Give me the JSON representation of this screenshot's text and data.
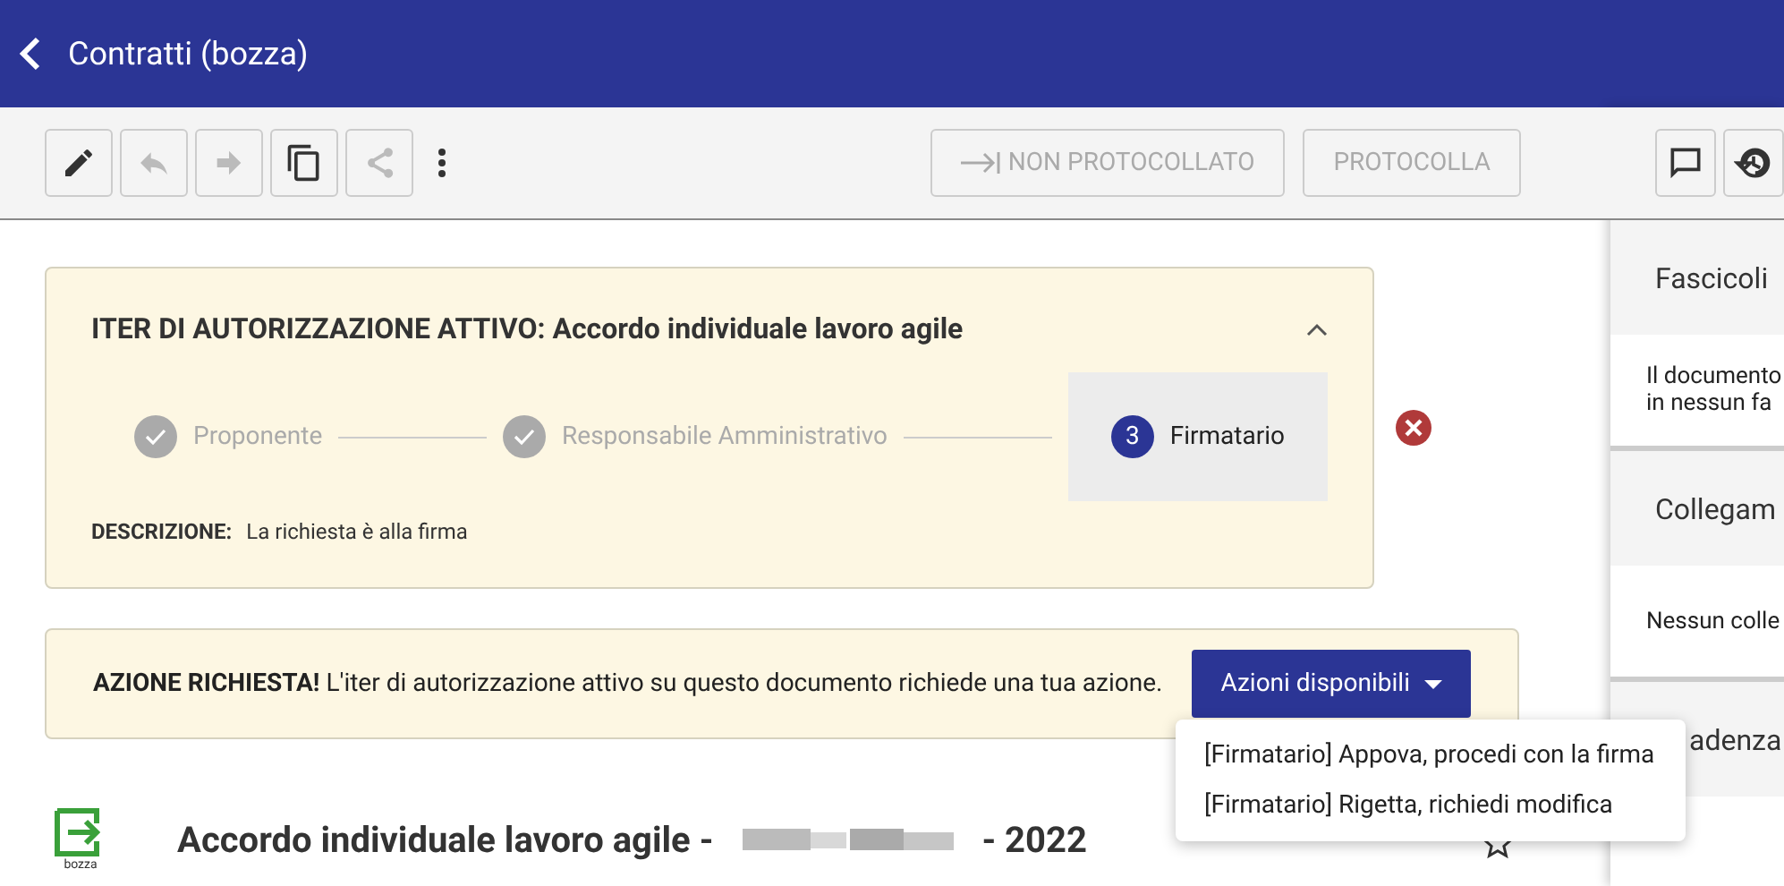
{
  "header": {
    "title": "Contratti (bozza)"
  },
  "toolbar": {
    "tools": [
      {
        "kind": "edit",
        "disabled": false
      },
      {
        "kind": "reply",
        "disabled": true
      },
      {
        "kind": "forward",
        "disabled": true
      },
      {
        "kind": "copy",
        "disabled": false
      },
      {
        "kind": "share",
        "disabled": true
      }
    ],
    "actions": [
      {
        "label": "NON PROTOCOLLATO",
        "kind": "arrow",
        "disabled": true
      },
      {
        "label": "PROTOCOLLA",
        "kind": "plain",
        "disabled": true
      }
    ]
  },
  "iter": {
    "title": "ITER DI AUTORIZZAZIONE ATTIVO: Accordo individuale lavoro agile",
    "expanded": true,
    "steps": [
      {
        "label": "Proponente",
        "completed": true,
        "selected": false
      },
      {
        "label": "Responsabile Amministrativo",
        "completed": true,
        "selected": false
      },
      {
        "label": "Firmatario",
        "number": "3",
        "completed": false,
        "selected": true
      }
    ],
    "description_label": "DESCRIZIONE:",
    "description": "La richiesta è alla firma"
  },
  "action_required": {
    "text": "**AZIONE RICHIESTA!** L'iter di autorizzazione attivo su questo documento richiede una tua azione.",
    "button": "Azioni disponibili",
    "menu_open": true,
    "menu": [
      "[Firmatario] Appova, procedi con la firma",
      "[Firmatario] Rigetta, richiedi modifica"
    ]
  },
  "document": {
    "badge": "bozza",
    "title_start": "Accordo individuale lavoro agile -",
    "title_end": "- 2022",
    "starred": false
  },
  "side_panel": {
    "sections": [
      {
        "title": "Fascicoli",
        "lines": [
          "Il documento",
          "in nessun fa"
        ]
      },
      {
        "title": "Collegam",
        "lines": [
          "Nessun colle"
        ]
      },
      {
        "title": "adenza",
        "covered_start": true
      }
    ]
  }
}
